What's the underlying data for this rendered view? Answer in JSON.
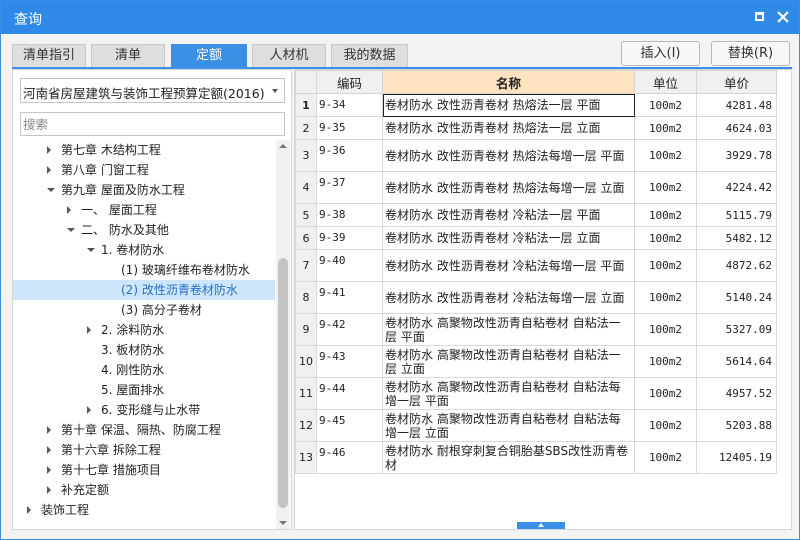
{
  "window": {
    "title": "查询"
  },
  "tabs": [
    {
      "label": "清单指引",
      "active": false
    },
    {
      "label": "清单",
      "active": false
    },
    {
      "label": "定额",
      "active": true
    },
    {
      "label": "人材机",
      "active": false
    },
    {
      "label": "我的数据",
      "active": false
    }
  ],
  "actions": {
    "insert_label": "插入(I)",
    "replace_label": "替换(R)"
  },
  "quota_library": {
    "selected": "河南省房屋建筑与装饰工程预算定额(2016)"
  },
  "search": {
    "placeholder": "搜索"
  },
  "tree": [
    {
      "label": "第七章 木结构工程",
      "expander": "collapsed",
      "level": 1
    },
    {
      "label": "第八章 门窗工程",
      "expander": "collapsed",
      "level": 1
    },
    {
      "label": "第九章 屋面及防水工程",
      "expander": "expanded",
      "level": 1
    },
    {
      "label": "一、 屋面工程",
      "expander": "collapsed",
      "level": 2
    },
    {
      "label": "二、 防水及其他",
      "expander": "expanded",
      "level": 2
    },
    {
      "label": "1. 卷材防水",
      "expander": "expanded",
      "level": 3
    },
    {
      "label": "(1) 玻璃纤维布卷材防水",
      "expander": "none",
      "level": 4
    },
    {
      "label": "(2) 改性沥青卷材防水",
      "expander": "none",
      "level": 4,
      "selected": true
    },
    {
      "label": "(3) 高分子卷材",
      "expander": "none",
      "level": 4
    },
    {
      "label": "2. 涂料防水",
      "expander": "collapsed",
      "level": 3
    },
    {
      "label": "3. 板材防水",
      "expander": "none",
      "level": 3
    },
    {
      "label": "4. 刚性防水",
      "expander": "none",
      "level": 3
    },
    {
      "label": "5. 屋面排水",
      "expander": "none",
      "level": 3
    },
    {
      "label": "6. 变形缝与止水带",
      "expander": "collapsed",
      "level": 3
    },
    {
      "label": "第十章 保温、隔热、防腐工程",
      "expander": "collapsed",
      "level": 1
    },
    {
      "label": "第十六章 拆除工程",
      "expander": "collapsed",
      "level": 1
    },
    {
      "label": "第十七章 措施项目",
      "expander": "collapsed",
      "level": 1
    },
    {
      "label": "补充定额",
      "expander": "collapsed",
      "level": 1
    },
    {
      "label": "装饰工程",
      "expander": "collapsed",
      "level": 0
    }
  ],
  "table": {
    "columns": {
      "code": "编码",
      "name": "名称",
      "unit": "单位",
      "price": "单价"
    },
    "rows": [
      {
        "no": "1",
        "code": "9-34",
        "name": "卷材防水 改性沥青卷材 热熔法一层 平面",
        "unit": "100m2",
        "price": "4281.48"
      },
      {
        "no": "2",
        "code": "9-35",
        "name": "卷材防水 改性沥青卷材 热熔法一层 立面",
        "unit": "100m2",
        "price": "4624.03"
      },
      {
        "no": "3",
        "code": "9-36",
        "name": "卷材防水 改性沥青卷材 热熔法每增一层 平面",
        "unit": "100m2",
        "price": "3929.78"
      },
      {
        "no": "4",
        "code": "9-37",
        "name": "卷材防水 改性沥青卷材 热熔法每增一层 立面",
        "unit": "100m2",
        "price": "4224.42"
      },
      {
        "no": "5",
        "code": "9-38",
        "name": "卷材防水 改性沥青卷材 冷粘法一层 平面",
        "unit": "100m2",
        "price": "5115.79"
      },
      {
        "no": "6",
        "code": "9-39",
        "name": "卷材防水 改性沥青卷材 冷粘法一层 立面",
        "unit": "100m2",
        "price": "5482.12"
      },
      {
        "no": "7",
        "code": "9-40",
        "name": "卷材防水 改性沥青卷材 冷粘法每增一层 平面",
        "unit": "100m2",
        "price": "4872.62"
      },
      {
        "no": "8",
        "code": "9-41",
        "name": "卷材防水 改性沥青卷材 冷粘法每增一层 立面",
        "unit": "100m2",
        "price": "5140.24"
      },
      {
        "no": "9",
        "code": "9-42",
        "name": "卷材防水 高聚物改性沥青自粘卷材 自粘法一层 平面",
        "unit": "100m2",
        "price": "5327.09"
      },
      {
        "no": "10",
        "code": "9-43",
        "name": "卷材防水 高聚物改性沥青自粘卷材 自粘法一层 立面",
        "unit": "100m2",
        "price": "5614.64"
      },
      {
        "no": "11",
        "code": "9-44",
        "name": "卷材防水 高聚物改性沥青自粘卷材 自粘法每增一层 平面",
        "unit": "100m2",
        "price": "4957.52"
      },
      {
        "no": "12",
        "code": "9-45",
        "name": "卷材防水 高聚物改性沥青自粘卷材 自粘法每增一层 立面",
        "unit": "100m2",
        "price": "5203.88"
      },
      {
        "no": "13",
        "code": "9-46",
        "name": "卷材防水 耐根穿刺复合铜胎基SBS改性沥青卷材",
        "unit": "100m2",
        "price": "12405.19"
      }
    ]
  },
  "colors": {
    "accent": "#2e8ae6",
    "selected_row": "#cde6fb",
    "name_header": "#fde3c0"
  }
}
